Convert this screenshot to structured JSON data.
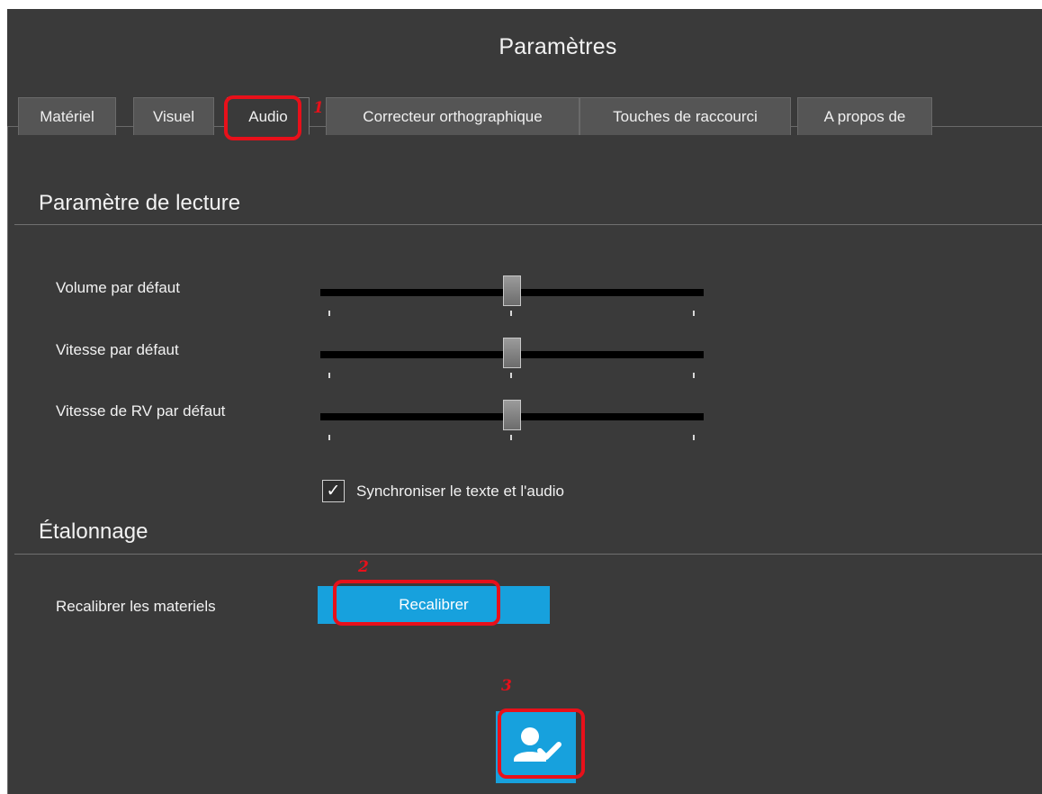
{
  "window": {
    "title": "Paramètres"
  },
  "tabs": [
    {
      "label": "Matériel",
      "active": false
    },
    {
      "label": "Visuel",
      "active": false
    },
    {
      "label": "Audio",
      "active": true
    },
    {
      "label": "Correcteur orthographique",
      "active": false
    },
    {
      "label": "Touches de raccourci",
      "active": false
    },
    {
      "label": "A propos de",
      "active": false
    }
  ],
  "playback": {
    "section_title": "Paramètre de lecture",
    "sliders": [
      {
        "label": "Volume par défaut",
        "value_fraction": 0.5
      },
      {
        "label": "Vitesse par défaut",
        "value_fraction": 0.5
      },
      {
        "label": "Vitesse de RV par défaut",
        "value_fraction": 0.5
      }
    ],
    "sync_checkbox": {
      "label": "Synchroniser le texte et l'audio",
      "checked": true,
      "glyph": "✓"
    }
  },
  "calibration": {
    "section_title": "Étalonnage",
    "row_label": "Recalibrer les materiels",
    "button_label": "Recalibrer"
  },
  "confirm_button": {
    "icon": "user-check-icon"
  },
  "annotations": [
    "1",
    "2",
    "3"
  ],
  "colors": {
    "background": "#3a3a3a",
    "accent": "#17a1dd",
    "annotation": "#e8101a",
    "text": "#f2f2f2"
  }
}
